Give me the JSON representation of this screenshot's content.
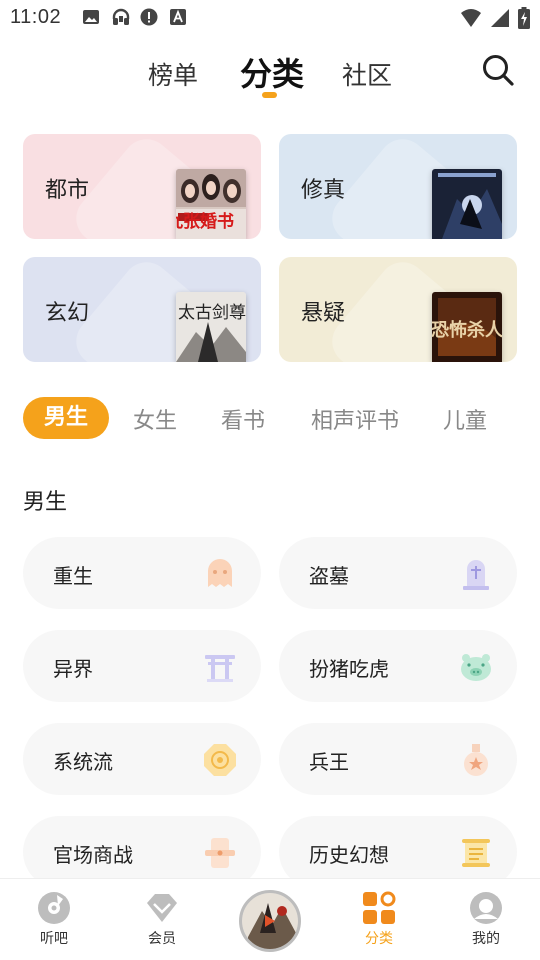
{
  "status_bar": {
    "time": "11:02",
    "left_icons": [
      "image-icon",
      "headset-icon",
      "alert-icon",
      "font-a-icon"
    ],
    "right_icons": [
      "wifi-icon",
      "cellular-signal-icon",
      "battery-charging-icon"
    ]
  },
  "top_nav": {
    "tabs": [
      {
        "label": "榜单"
      },
      {
        "label": "分类"
      },
      {
        "label": "社区"
      }
    ],
    "active_tab": "分类",
    "search_icon": "search-icon"
  },
  "colors": {
    "accent": "#f5a21b",
    "chip_bg": "#f7f7f7"
  },
  "category_cards": [
    {
      "label": "都市",
      "bg": "#f9dfe2",
      "cover_text": "开局九张婚书"
    },
    {
      "label": "修真",
      "bg": "#dae6f2",
      "cover_text": ""
    },
    {
      "label": "玄幻",
      "bg": "#dde2f1",
      "cover_text": "太古剑尊"
    },
    {
      "label": "悬疑",
      "bg": "#f2ecd6",
      "cover_text": "恐怖杀人"
    }
  ],
  "gender_tabs": [
    {
      "label": "男生"
    },
    {
      "label": "女生"
    },
    {
      "label": "看书"
    },
    {
      "label": "相声评书"
    },
    {
      "label": "儿童"
    }
  ],
  "active_gender_tab": "男生",
  "section": {
    "title": "男生",
    "chips": [
      {
        "label": "重生",
        "icon": "ghost-icon"
      },
      {
        "label": "盗墓",
        "icon": "tombstone-icon"
      },
      {
        "label": "异界",
        "icon": "torii-gate-icon"
      },
      {
        "label": "扮猪吃虎",
        "icon": "pig-icon"
      },
      {
        "label": "系统流",
        "icon": "octagon-target-icon"
      },
      {
        "label": "兵王",
        "icon": "medal-icon"
      },
      {
        "label": "官场商战",
        "icon": "scroll-icon"
      },
      {
        "label": "历史幻想",
        "icon": "book-scroll-icon"
      }
    ]
  },
  "bottom_nav": {
    "items": [
      {
        "label": "听吧",
        "icon": "music-disc-icon"
      },
      {
        "label": "会员",
        "icon": "vip-diamond-icon"
      },
      {
        "label": "",
        "icon": "now-playing-disc-icon"
      },
      {
        "label": "分类",
        "icon": "category-grid-icon"
      },
      {
        "label": "我的",
        "icon": "profile-icon"
      }
    ],
    "active": "分类"
  }
}
